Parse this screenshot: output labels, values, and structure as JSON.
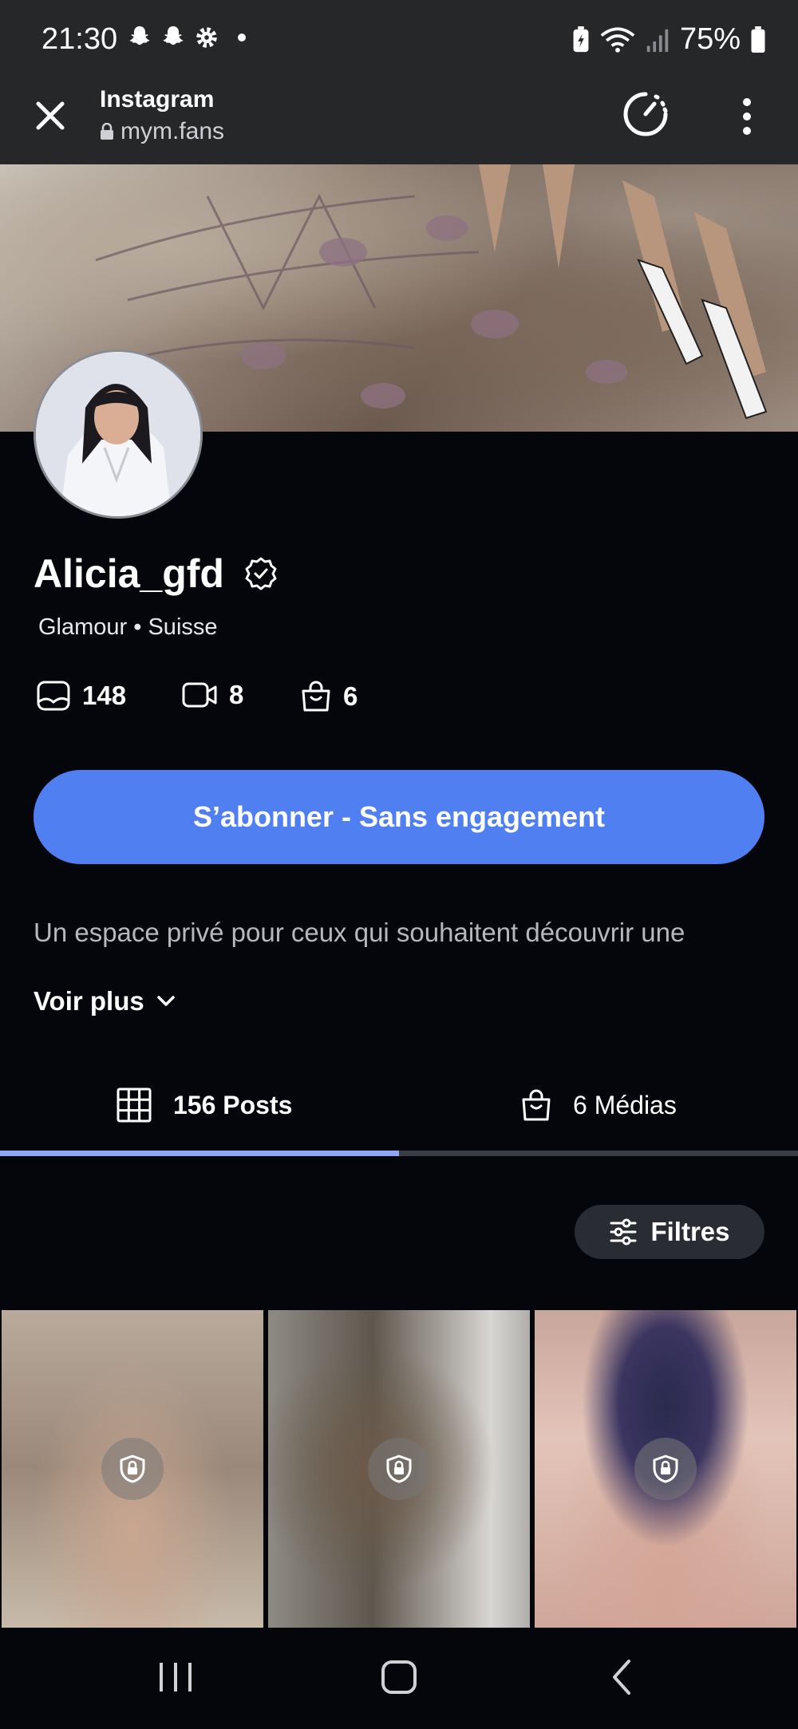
{
  "status_bar": {
    "time": "21:30",
    "left_icons": [
      "snapchat-icon",
      "snapchat-icon",
      "gear-icon",
      "dot-icon"
    ],
    "right_icons": [
      "battery-saver-icon",
      "wifi-icon",
      "signal-icon"
    ],
    "battery": "75%"
  },
  "browser": {
    "title": "Instagram",
    "url": "mym.fans"
  },
  "profile": {
    "username": "Alicia_gfd",
    "tagline": "Glamour • Suisse",
    "stats": {
      "photos": "148",
      "videos": "8",
      "medias": "6"
    },
    "subscribe_label": "S’abonner - Sans engagement",
    "bio": "Un espace privé pour ceux qui souhaitent découvrir une",
    "see_more_label": "Voir plus"
  },
  "tabs": [
    {
      "label": "156 Posts",
      "active": true
    },
    {
      "label": "6 Médias",
      "active": false
    }
  ],
  "filters_label": "Filtres",
  "colors": {
    "accent": "#4f7ff1",
    "background": "#05060b",
    "tab_indicator": "#8fa6f5"
  }
}
